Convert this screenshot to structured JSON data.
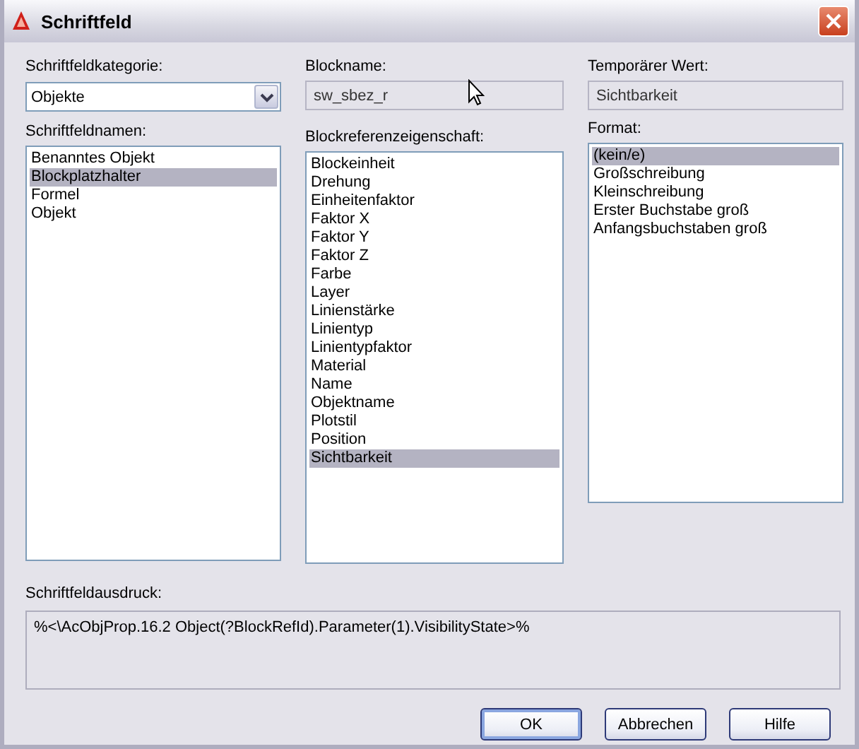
{
  "window": {
    "title": "Schriftfeld"
  },
  "category": {
    "label": "Schriftfeldkategorie:",
    "value": "Objekte"
  },
  "field_names": {
    "label": "Schriftfeldnamen:",
    "items": [
      {
        "label": "Benanntes Objekt",
        "selected": false
      },
      {
        "label": "Blockplatzhalter",
        "selected": true
      },
      {
        "label": "Formel",
        "selected": false
      },
      {
        "label": "Objekt",
        "selected": false
      }
    ]
  },
  "block_name": {
    "label": "Blockname:",
    "value": "sw_sbez_r"
  },
  "block_property": {
    "label": "Blockreferenzeigenschaft:",
    "items": [
      {
        "label": "Blockeinheit",
        "selected": false
      },
      {
        "label": "Drehung",
        "selected": false
      },
      {
        "label": "Einheitenfaktor",
        "selected": false
      },
      {
        "label": "Faktor X",
        "selected": false
      },
      {
        "label": "Faktor Y",
        "selected": false
      },
      {
        "label": "Faktor Z",
        "selected": false
      },
      {
        "label": "Farbe",
        "selected": false
      },
      {
        "label": "Layer",
        "selected": false
      },
      {
        "label": "Linienstärke",
        "selected": false
      },
      {
        "label": "Linientyp",
        "selected": false
      },
      {
        "label": "Linientypfaktor",
        "selected": false
      },
      {
        "label": "Material",
        "selected": false
      },
      {
        "label": "Name",
        "selected": false
      },
      {
        "label": "Objektname",
        "selected": false
      },
      {
        "label": "Plotstil",
        "selected": false
      },
      {
        "label": "Position",
        "selected": false
      },
      {
        "label": "Sichtbarkeit",
        "selected": true
      }
    ]
  },
  "temp_value": {
    "label": "Temporärer Wert:",
    "value": "Sichtbarkeit"
  },
  "format": {
    "label": "Format:",
    "items": [
      {
        "label": "(kein/e)",
        "selected": true
      },
      {
        "label": "Großschreibung",
        "selected": false
      },
      {
        "label": "Kleinschreibung",
        "selected": false
      },
      {
        "label": "Erster Buchstabe groß",
        "selected": false
      },
      {
        "label": "Anfangsbuchstaben groß",
        "selected": false
      }
    ]
  },
  "expression": {
    "label": "Schriftfeldausdruck:",
    "value": "%<\\AcObjProp.16.2 Object(?BlockRefId).Parameter(1).VisibilityState>%"
  },
  "buttons": [
    {
      "label": "OK",
      "default": true
    },
    {
      "label": "Abbrechen",
      "default": false
    },
    {
      "label": "Hilfe",
      "default": false
    }
  ]
}
